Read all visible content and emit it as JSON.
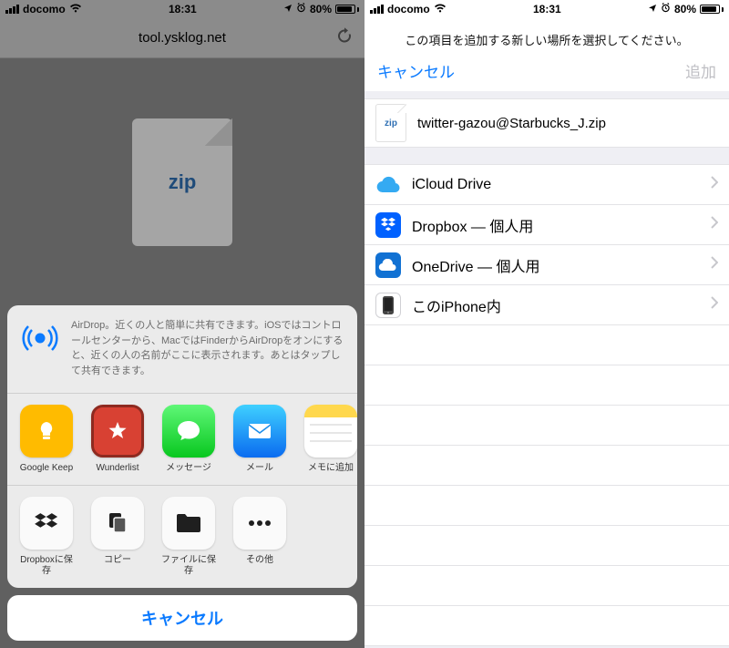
{
  "status": {
    "carrier": "docomo",
    "time": "18:31",
    "battery_pct": "80%"
  },
  "left": {
    "url": "tool.ysklog.net",
    "zip_label": "zip",
    "airdrop_text": "AirDrop。近くの人と簡単に共有できます。iOSではコントロールセンターから、MacではFinderからAirDropをオンにすると、近くの人の名前がここに表示されます。あとはタップして共有できます。",
    "apps": [
      {
        "name": "Google Keep"
      },
      {
        "name": "Wunderlist"
      },
      {
        "name": "メッセージ"
      },
      {
        "name": "メール"
      },
      {
        "name": "メモに追加"
      }
    ],
    "actions": [
      {
        "name": "Dropboxに保存"
      },
      {
        "name": "コピー"
      },
      {
        "name": "ファイルに保存"
      },
      {
        "name": "その他"
      }
    ],
    "cancel": "キャンセル"
  },
  "right": {
    "help": "この項目を追加する新しい場所を選択してください。",
    "cancel": "キャンセル",
    "add": "追加",
    "file_badge": "zip",
    "filename": "twitter-gazou@Starbucks_J.zip",
    "locations": [
      {
        "name": "iCloud Drive"
      },
      {
        "name": "Dropbox — 個人用"
      },
      {
        "name": "OneDrive — 個人用"
      },
      {
        "name": "このiPhone内"
      }
    ]
  }
}
